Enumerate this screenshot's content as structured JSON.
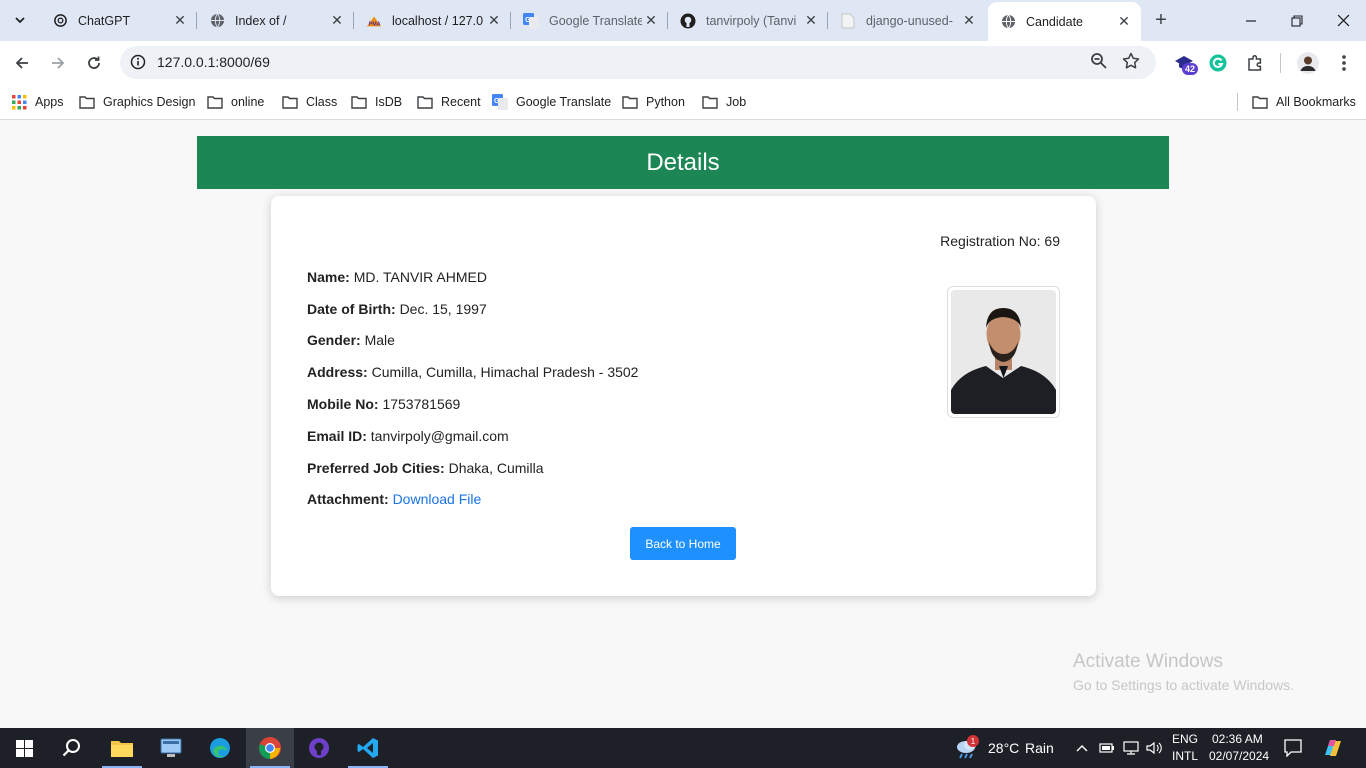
{
  "browser": {
    "tabs": [
      {
        "title": "ChatGPT",
        "icon": "chatgpt-icon"
      },
      {
        "title": "Index of /",
        "icon": "globe-icon"
      },
      {
        "title": "localhost / 127.0",
        "icon": "phpmyadmin-icon"
      },
      {
        "title": "Google Translate",
        "icon": "google-translate-icon"
      },
      {
        "title": "tanvirpoly (Tanvi",
        "icon": "github-icon"
      },
      {
        "title": "django-unused-",
        "icon": "page-icon"
      },
      {
        "title": "Candidate",
        "icon": "globe-icon"
      }
    ],
    "url": "127.0.0.1:8000/69",
    "extension_badge": "42",
    "bookmarks": [
      {
        "label": "Apps",
        "icon": "apps-grid-icon"
      },
      {
        "label": "Graphics Design",
        "icon": "folder-icon"
      },
      {
        "label": "online",
        "icon": "folder-icon"
      },
      {
        "label": "Class",
        "icon": "folder-icon"
      },
      {
        "label": "IsDB",
        "icon": "folder-icon"
      },
      {
        "label": "Recent",
        "icon": "folder-icon"
      },
      {
        "label": "Google Translate",
        "icon": "google-translate-icon"
      },
      {
        "label": "Python",
        "icon": "folder-icon"
      },
      {
        "label": "Job",
        "icon": "folder-icon"
      }
    ],
    "all_bookmarks": "All Bookmarks"
  },
  "page": {
    "header": "Details",
    "registration_label": "Registration No:",
    "registration_no": "69",
    "fields": [
      {
        "label": "Name:",
        "value": "MD. TANVIR AHMED"
      },
      {
        "label": "Date of Birth:",
        "value": "Dec. 15, 1997"
      },
      {
        "label": "Gender:",
        "value": "Male"
      },
      {
        "label": "Address:",
        "value": "Cumilla, Cumilla, Himachal Pradesh - 3502"
      },
      {
        "label": "Mobile No:",
        "value": "1753781569"
      },
      {
        "label": "Email ID:",
        "value": "tanvirpoly@gmail.com"
      },
      {
        "label": "Preferred Job Cities:",
        "value": "Dhaka, Cumilla"
      }
    ],
    "attachment_label": "Attachment:",
    "attachment_link": "Download File",
    "back_button": "Back to Home",
    "colors": {
      "header": "#1c8754",
      "button": "#1e90ff",
      "link": "#1a73e8"
    }
  },
  "watermark": {
    "title": "Activate Windows",
    "subtitle": "Go to Settings to activate Windows."
  },
  "taskbar": {
    "weather_temp": "28°C",
    "weather_text": "Rain",
    "weather_alert": "1",
    "lang_top": "ENG",
    "lang_bottom": "INTL",
    "time": "02:36 AM",
    "date": "02/07/2024"
  }
}
